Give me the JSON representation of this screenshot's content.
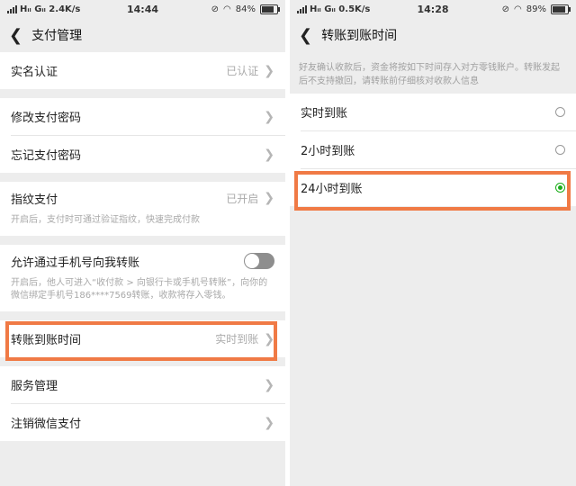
{
  "left": {
    "status": {
      "carrier": "Hᵢₗ Gᵢₗ 2.4K/s",
      "time": "14:44",
      "battery": "84%",
      "battery_level": 0.84
    },
    "nav": {
      "back": "<",
      "title": "支付管理"
    },
    "rows": {
      "realname": {
        "label": "实名认证",
        "value": "已认证"
      },
      "change_pwd": {
        "label": "修改支付密码"
      },
      "forgot_pwd": {
        "label": "忘记支付密码"
      },
      "fingerprint": {
        "label": "指纹支付",
        "value": "已开启",
        "desc": "开启后，支付时可通过验证指纹，快速完成付款"
      },
      "phone_transfer": {
        "label": "允许通过手机号向我转账",
        "desc": "开启后，他人可进入“收付款 > 向银行卡或手机号转账”，向你的微信绑定手机号186****7569转账，收款将存入零钱。"
      },
      "arrival_time": {
        "label": "转账到账时间",
        "value": "实时到账"
      },
      "service": {
        "label": "服务管理"
      },
      "cancel": {
        "label": "注销微信支付"
      }
    }
  },
  "right": {
    "status": {
      "carrier": "Hᵢₗ Gᵢₗ 0.5K/s",
      "time": "14:28",
      "battery": "89%",
      "battery_level": 0.89
    },
    "nav": {
      "back": "<",
      "title": "转账到账时间"
    },
    "info": "好友确认收款后，资金将按如下时间存入对方零钱账户。转账发起后不支持撤回，请转账前仔细核对收款人信息",
    "options": [
      {
        "label": "实时到账",
        "selected": false
      },
      {
        "label": "2小时到账",
        "selected": false
      },
      {
        "label": "24小时到账",
        "selected": true
      }
    ]
  },
  "colors": {
    "accent": "#1aad19",
    "highlight": "#f07a45",
    "background": "#ededed"
  }
}
